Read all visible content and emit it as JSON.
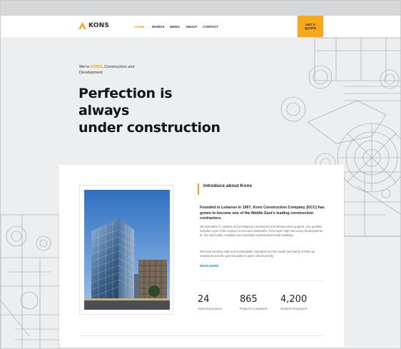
{
  "brand": {
    "name": "KONS",
    "accent": "#f7a919"
  },
  "nav": {
    "items": [
      {
        "label": "HOME",
        "active": true
      },
      {
        "label": "WORKS",
        "active": false
      },
      {
        "label": "NEWS",
        "active": false
      },
      {
        "label": "ABOUT",
        "active": false
      },
      {
        "label": "CONTACT",
        "active": false
      }
    ],
    "cta_label": "GET A QUOTE"
  },
  "hero": {
    "kicker_prefix": "We're ",
    "kicker_brand": "KONS",
    "kicker_suffix": ", Construction and Development",
    "title_line1": "Perfection is",
    "title_line2": "always",
    "title_line3": "under construction"
  },
  "about": {
    "heading": "Introduce about Kons",
    "lead": "Founded in Lebanon in 1967, Kons Construction Company (KCC) has grown to become one of the Middle East's leading construction contractors.",
    "paragraph1": "We specialise in complex and prestigious construction and infrastructure projects. Our portfolio includes some of the region's most iconic landmarks, from super high-rise luxury developments, to: five star hotels, hospitals and intricately sophisticated smart buildings.",
    "paragraph2": "We have exacting HSE and sustainability standards and the health and safety of both our employees and the general public is given utmost priority.",
    "read_more": "READ MORE"
  },
  "stats": [
    {
      "value": "24",
      "label": "Years Experience"
    },
    {
      "value": "865",
      "label": "Projects Completed"
    },
    {
      "value": "4,200",
      "label": "Workers Employed"
    }
  ]
}
